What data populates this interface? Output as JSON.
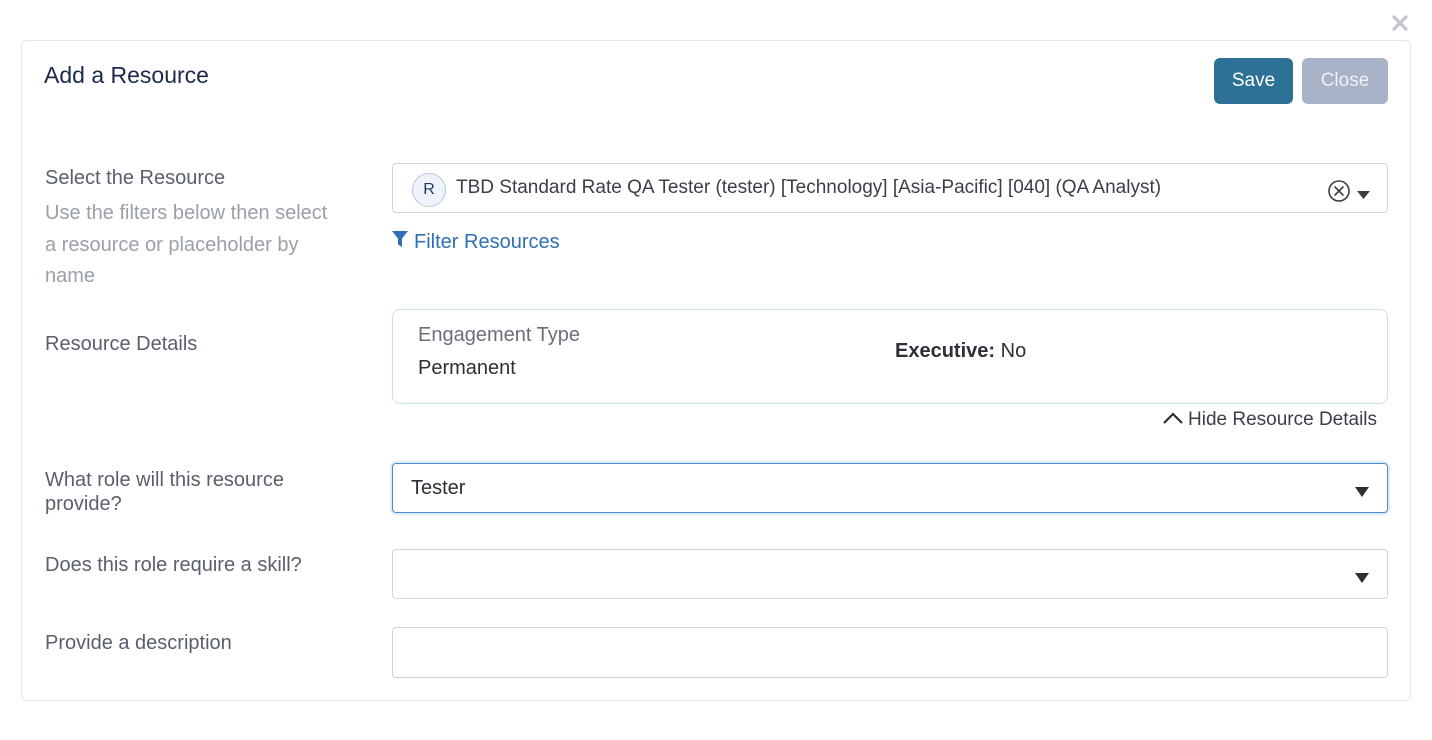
{
  "dialog": {
    "title": "Add a Resource",
    "save_label": "Save",
    "close_label": "Close"
  },
  "resource": {
    "label": "Select the Resource",
    "help": "Use the filters below then select a resource or placeholder by name",
    "avatar_initial": "R",
    "selected_value": "TBD Standard Rate QA Tester (tester) [Technology] [Asia-Pacific] [040] (QA Analyst)",
    "filter_link": "Filter Resources"
  },
  "details": {
    "label": "Resource Details",
    "engagement_label": "Engagement Type",
    "engagement_value": "Permanent",
    "executive_label": "Executive:",
    "executive_value": "No",
    "hide_link": "Hide Resource Details"
  },
  "role": {
    "label": "What role will this resource provide?",
    "value": "Tester"
  },
  "skill": {
    "label": "Does this role require a skill?",
    "value": ""
  },
  "description": {
    "label": "Provide a description",
    "value": "",
    "placeholder": ""
  },
  "colors": {
    "primary": "#2e7197",
    "disabled": "#a9b3c7",
    "link": "#2f6fb5"
  }
}
